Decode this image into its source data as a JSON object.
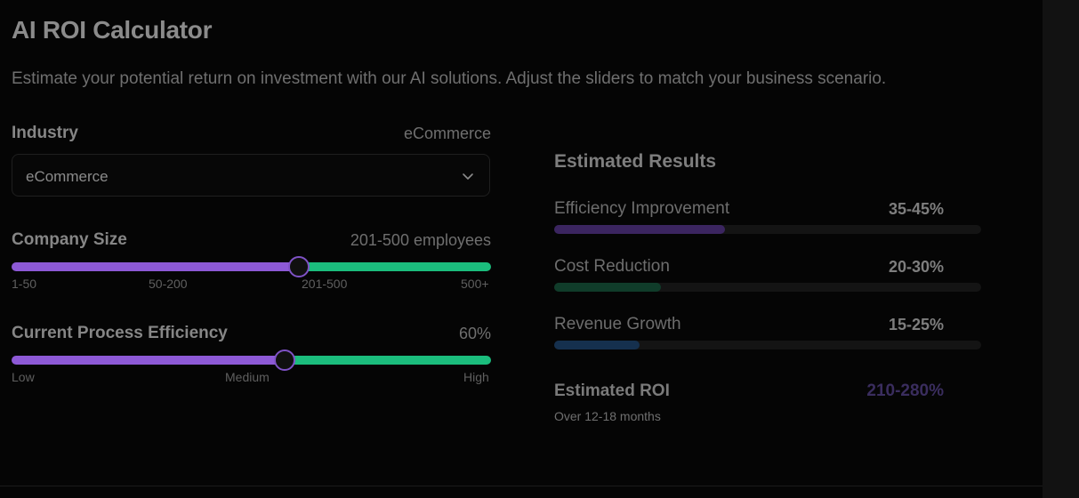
{
  "page": {
    "title": "AI ROI Calculator",
    "subtitle": "Estimate your potential return on investment with our AI solutions. Adjust the sliders to match your business scenario."
  },
  "industry": {
    "label": "Industry",
    "value_display": "eCommerce",
    "selected": "eCommerce",
    "icon": "chevron-down-icon"
  },
  "company_size": {
    "label": "Company Size",
    "value_display": "201-500 employees",
    "ticks": [
      "1-50",
      "50-200",
      "201-500",
      "500+"
    ],
    "position_fraction": 0.6
  },
  "process_efficiency": {
    "label": "Current Process Efficiency",
    "value_display": "60%",
    "ticks": [
      "Low",
      "Medium",
      "High"
    ],
    "position_fraction": 0.57
  },
  "results": {
    "title": "Estimated Results",
    "items": [
      {
        "label": "Efficiency Improvement",
        "value": "35-45%",
        "fill_fraction": 0.4,
        "color": "#3b2560"
      },
      {
        "label": "Cost Reduction",
        "value": "20-30%",
        "fill_fraction": 0.25,
        "color": "#103c2a"
      },
      {
        "label": "Revenue Growth",
        "value": "15-25%",
        "fill_fraction": 0.2,
        "color": "#15304e"
      }
    ],
    "roi_label": "Estimated ROI",
    "roi_value": "210-280%",
    "roi_sub": "Over 12-18 months"
  },
  "colors": {
    "slider_purple": "#8d59d6",
    "slider_green": "#1bbd7d",
    "roi_accent": "#3a2d5e"
  }
}
